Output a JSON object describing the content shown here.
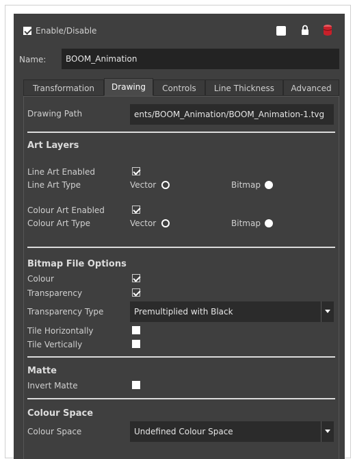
{
  "header": {
    "enable_label": "Enable/Disable",
    "enable_checked": true,
    "icons": [
      "color-swatch-icon",
      "lock-icon",
      "database-icon"
    ]
  },
  "name": {
    "label": "Name:",
    "value": "BOOM_Animation"
  },
  "tabs": [
    "Transformation",
    "Drawing",
    "Controls",
    "Line Thickness",
    "Advanced"
  ],
  "active_tab": "Drawing",
  "drawing_path": {
    "label": "Drawing Path",
    "value": "ents/BOOM_Animation/BOOM_Animation-1.tvg"
  },
  "art_layers": {
    "title": "Art Layers",
    "line_art_enabled": "Line Art Enabled",
    "line_art_type": "Line Art Type",
    "colour_art_enabled": "Colour Art Enabled",
    "colour_art_type": "Colour Art Type",
    "vector": "Vector",
    "bitmap": "Bitmap"
  },
  "bitmap_options": {
    "title": "Bitmap File Options",
    "colour": "Colour",
    "transparency": "Transparency",
    "transparency_type": "Transparency Type",
    "transparency_type_value": "Premultiplied with Black",
    "tile_horizontally": "Tile Horizontally",
    "tile_vertically": "Tile Vertically"
  },
  "matte": {
    "title": "Matte",
    "invert": "Invert Matte"
  },
  "colour_space": {
    "title": "Colour Space",
    "label": "Colour Space",
    "value": "Undefined Colour Space"
  },
  "colors": {
    "panel": "#3f3f3f",
    "field": "#2b2b2b",
    "separator": "#dcdcdc",
    "lock_icon": "#ffffff",
    "db_icon": "#d8303a"
  }
}
